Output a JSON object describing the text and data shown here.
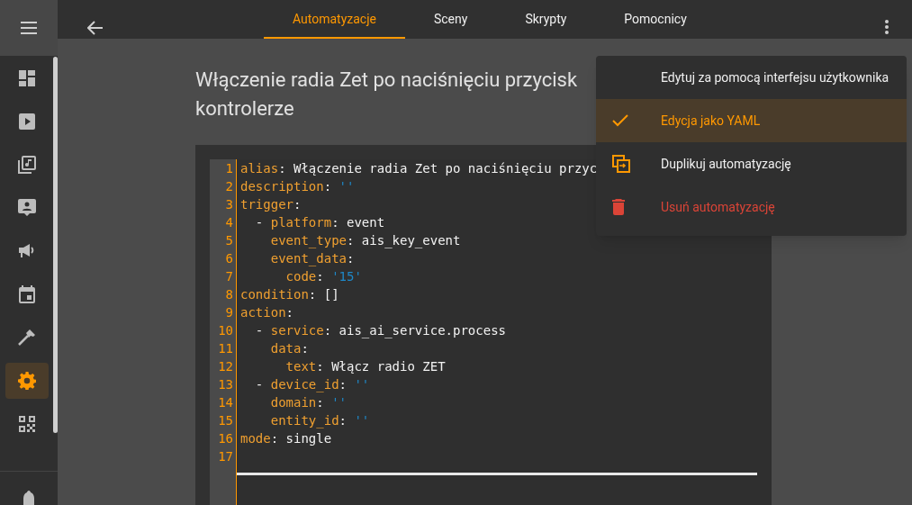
{
  "sidebar": {
    "items": [
      {
        "selected": false
      },
      {
        "selected": false
      },
      {
        "selected": false
      },
      {
        "selected": false
      },
      {
        "selected": false
      },
      {
        "selected": false
      },
      {
        "selected": false
      },
      {
        "selected": true
      },
      {
        "selected": false
      }
    ]
  },
  "tabs": [
    {
      "label": "Automatyzacje",
      "selected": true
    },
    {
      "label": "Sceny",
      "selected": false
    },
    {
      "label": "Skrypty",
      "selected": false
    },
    {
      "label": "Pomocnicy",
      "selected": false
    }
  ],
  "title_lines": [
    "Włączenie radia Zet po naciśnięciu przycisk",
    "kontrolerze"
  ],
  "code": [
    {
      "number": "1",
      "kind": "root",
      "tokens": [
        {
          "kind": "key",
          "text": "alias"
        },
        {
          "kind": "text",
          "text": ": Włączenie radia Zet po naciśnięciu przyc"
        }
      ]
    },
    {
      "number": "2",
      "kind": "root",
      "tokens": [
        {
          "kind": "key",
          "text": "description"
        },
        {
          "kind": "text",
          "text": ": "
        },
        {
          "kind": "string",
          "text": "''"
        }
      ]
    },
    {
      "number": "3",
      "kind": "root",
      "tokens": [
        {
          "kind": "key",
          "text": "trigger"
        },
        {
          "kind": "text",
          "text": ":"
        }
      ]
    },
    {
      "number": "4",
      "kind": "list",
      "tokens": [
        {
          "kind": "text",
          "text": "- "
        },
        {
          "kind": "key",
          "text": "platform"
        },
        {
          "kind": "text",
          "text": ": event"
        }
      ]
    },
    {
      "number": "5",
      "kind": "child",
      "tokens": [
        {
          "kind": "key",
          "text": "event_type"
        },
        {
          "kind": "text",
          "text": ": ais_key_event"
        }
      ]
    },
    {
      "number": "6",
      "kind": "child",
      "tokens": [
        {
          "kind": "key",
          "text": "event_data"
        },
        {
          "kind": "text",
          "text": ":"
        }
      ]
    },
    {
      "number": "7",
      "kind": "grandchild",
      "tokens": [
        {
          "kind": "key",
          "text": "code"
        },
        {
          "kind": "text",
          "text": ": "
        },
        {
          "kind": "string",
          "text": "'15'"
        }
      ]
    },
    {
      "number": "8",
      "kind": "root",
      "tokens": [
        {
          "kind": "key",
          "text": "condition"
        },
        {
          "kind": "text",
          "text": ": []"
        }
      ]
    },
    {
      "number": "9",
      "kind": "root",
      "tokens": [
        {
          "kind": "key",
          "text": "action"
        },
        {
          "kind": "text",
          "text": ":"
        }
      ]
    },
    {
      "number": "10",
      "kind": "list",
      "tokens": [
        {
          "kind": "text",
          "text": "- "
        },
        {
          "kind": "key",
          "text": "service"
        },
        {
          "kind": "text",
          "text": ": ais_ai_service.process"
        }
      ]
    },
    {
      "number": "11",
      "kind": "child",
      "tokens": [
        {
          "kind": "key",
          "text": "data"
        },
        {
          "kind": "text",
          "text": ":"
        }
      ]
    },
    {
      "number": "12",
      "kind": "grandchild",
      "tokens": [
        {
          "kind": "key",
          "text": "text"
        },
        {
          "kind": "text",
          "text": ": Włącz radio ZET"
        }
      ]
    },
    {
      "number": "13",
      "kind": "list",
      "tokens": [
        {
          "kind": "text",
          "text": "- "
        },
        {
          "kind": "key",
          "text": "device_id"
        },
        {
          "kind": "text",
          "text": ": "
        },
        {
          "kind": "string",
          "text": "''"
        }
      ]
    },
    {
      "number": "14",
      "kind": "child",
      "tokens": [
        {
          "kind": "key",
          "text": "domain"
        },
        {
          "kind": "text",
          "text": ": "
        },
        {
          "kind": "string",
          "text": "''"
        }
      ]
    },
    {
      "number": "15",
      "kind": "child",
      "tokens": [
        {
          "kind": "key",
          "text": "entity_id"
        },
        {
          "kind": "text",
          "text": ": "
        },
        {
          "kind": "string",
          "text": "''"
        }
      ]
    },
    {
      "number": "16",
      "kind": "root",
      "tokens": [
        {
          "kind": "key",
          "text": "mode"
        },
        {
          "kind": "text",
          "text": ": single"
        }
      ]
    },
    {
      "number": "17",
      "kind": "root"
    }
  ],
  "menu": {
    "items": [
      {
        "label": "Edytuj za pomocą interfejsu użytkownika",
        "kind": "plain",
        "selected": false
      },
      {
        "label": "Edycja jako YAML",
        "kind": "check",
        "selected": true
      },
      {
        "label": "Duplikuj automatyzację",
        "kind": "duplicate",
        "selected": false
      },
      {
        "label": "Usuń automatyzację",
        "kind": "delete",
        "selected": false
      }
    ]
  }
}
